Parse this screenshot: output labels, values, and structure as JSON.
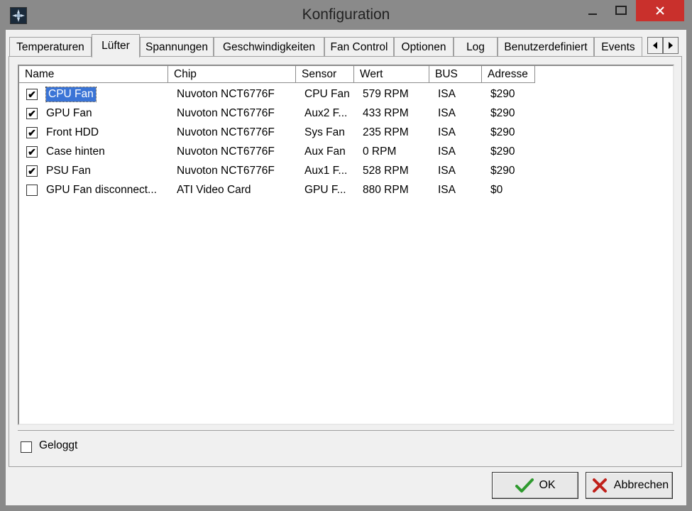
{
  "window": {
    "title": "Konfiguration",
    "icon": "fan-app-icon"
  },
  "tabs": [
    {
      "label": "Temperaturen",
      "active": false
    },
    {
      "label": "Lüfter",
      "active": true
    },
    {
      "label": "Spannungen",
      "active": false
    },
    {
      "label": "Geschwindigkeiten",
      "active": false
    },
    {
      "label": "Fan Control",
      "active": false
    },
    {
      "label": "Optionen",
      "active": false
    },
    {
      "label": "Log",
      "active": false
    },
    {
      "label": "Benutzerdefiniert",
      "active": false
    },
    {
      "label": "Events",
      "active": false
    }
  ],
  "table": {
    "columns": [
      "Name",
      "Chip",
      "Sensor",
      "Wert",
      "BUS",
      "Adresse"
    ],
    "rows": [
      {
        "checked": true,
        "name": "CPU Fan",
        "chip": "Nuvoton NCT6776F",
        "sensor": "CPU Fan",
        "value": "579 RPM",
        "bus": "ISA",
        "address": "$290",
        "selected": true
      },
      {
        "checked": true,
        "name": "GPU Fan",
        "chip": "Nuvoton NCT6776F",
        "sensor": "Aux2 F...",
        "value": "433 RPM",
        "bus": "ISA",
        "address": "$290",
        "selected": false
      },
      {
        "checked": true,
        "name": "Front HDD",
        "chip": "Nuvoton NCT6776F",
        "sensor": "Sys Fan",
        "value": "235 RPM",
        "bus": "ISA",
        "address": "$290",
        "selected": false
      },
      {
        "checked": true,
        "name": "Case hinten",
        "chip": "Nuvoton NCT6776F",
        "sensor": "Aux Fan",
        "value": "0 RPM",
        "bus": "ISA",
        "address": "$290",
        "selected": false
      },
      {
        "checked": true,
        "name": "PSU Fan",
        "chip": "Nuvoton NCT6776F",
        "sensor": "Aux1 F...",
        "value": "528 RPM",
        "bus": "ISA",
        "address": "$290",
        "selected": false
      },
      {
        "checked": false,
        "name": "GPU Fan disconnect...",
        "chip": "ATI Video Card",
        "sensor": "GPU F...",
        "value": "880 RPM",
        "bus": "ISA",
        "address": "$0",
        "selected": false
      }
    ]
  },
  "logged": {
    "label": "Geloggt",
    "checked": false
  },
  "buttons": {
    "ok_label": "OK",
    "cancel_label": "Abbrechen"
  },
  "colors": {
    "selection": "#3a74d6",
    "close_button": "#c9302c",
    "ok_icon": "#2e9a2e",
    "cancel_icon": "#c0201a"
  }
}
